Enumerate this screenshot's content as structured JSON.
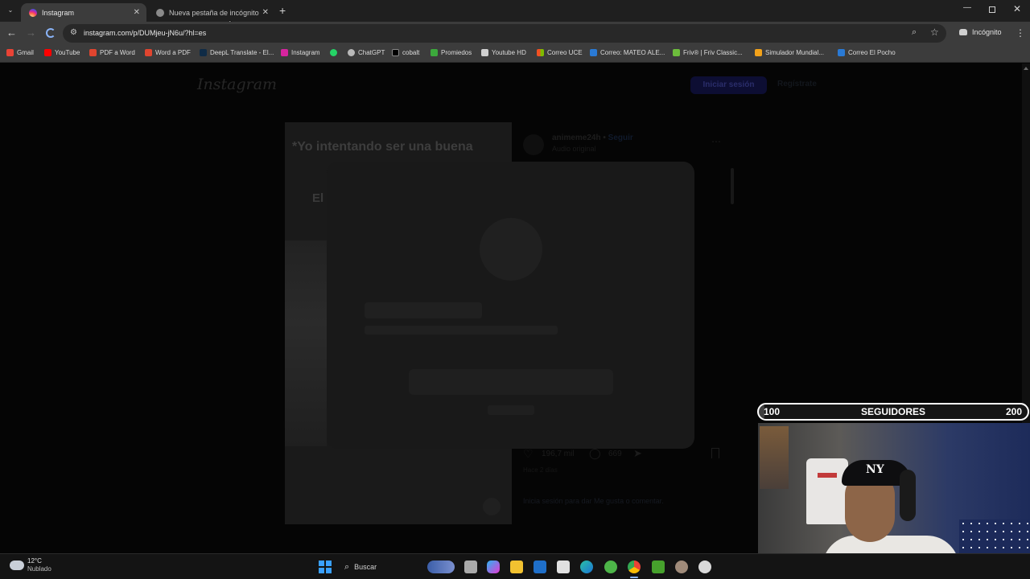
{
  "browser": {
    "tabs": [
      {
        "title": "Instagram",
        "active": true
      },
      {
        "title": "Nueva pestaña de incógnito",
        "active": false
      }
    ],
    "url": "instagram.com/p/DUMjeu-jN6u/?hl=es",
    "profile_label": "Incógnito",
    "bookmarks": [
      "Gmail",
      "YouTube",
      "PDF a Word",
      "Word a PDF",
      "DeepL Translate - El...",
      "Instagram",
      "ChatGPT",
      "cobalt",
      "Promiedos",
      "Youtube HD",
      "Correo UCE",
      "Correo: MATEO ALE...",
      "Friv® | Friv Classic...",
      "Simulador Mundial...",
      "Correo El Pocho"
    ]
  },
  "page": {
    "logo": "Instagram",
    "login_button": "Iniciar sesión",
    "signup_link": "Regístrate",
    "post": {
      "caption_overlay": "*Yo intentando ser una buena",
      "caption_partial": "El",
      "username": "animeme24h",
      "follow": "Seguir",
      "audio": "Audio original",
      "likes": "196,7 mil",
      "comments": "669",
      "time": "Hace 2 días",
      "login_prompt": "Inicia sesión para dar Me gusta o comentar."
    }
  },
  "stream": {
    "followers_label": "SEGUIDORES",
    "followers_min": "100",
    "followers_max": "200",
    "followers_progress": 0.02
  },
  "taskbar": {
    "weather_temp": "12°C",
    "weather_desc": "Nublado",
    "search_label": "Buscar"
  }
}
